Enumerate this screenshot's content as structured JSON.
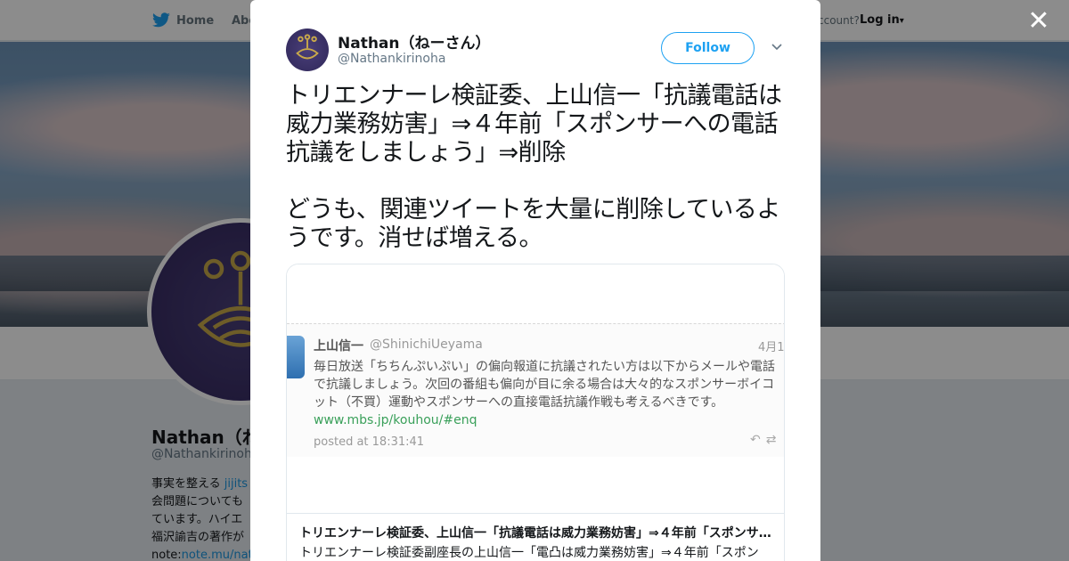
{
  "nav": {
    "home_label": "Home",
    "about_label": "Abo",
    "account_text": "ccount?",
    "login_label": "Log in"
  },
  "background_profile": {
    "name": "Nathan（ね",
    "handle": "@Nathankirinoha",
    "bio_lines": [
      {
        "text": "事実を整える ",
        "link": "jijits"
      },
      {
        "text": "会問題についても",
        "link": ""
      },
      {
        "text": "ています。ハイエ",
        "link": ""
      },
      {
        "text": "福沢諭吉の著作が",
        "link": ""
      },
      {
        "text": "note:",
        "link": "note.mu/nath"
      }
    ]
  },
  "tweet": {
    "author_name": "Nathan（ねーさん）",
    "author_handle": "@Nathankirinoha",
    "follow_label": "Follow",
    "text": "トリエンナーレ検証委、上山信一「抗議電話は威力業務妨害」⇒４年前「スポンサーへの電話抗議をしましょう」⇒削除\n\nどうも、関連ツイートを大量に削除しているようです。消せば増える。"
  },
  "card": {
    "screenshot": {
      "name": "上山信一",
      "handle": "@ShinichiUeyama",
      "date": "4月1",
      "body_lines": [
        "毎日放送「ちちんぷいぷい」の偏向報道に抗議されたい方は以下からメールや電話",
        "で抗議しましょう。次回の番組も偏向が目に余る場合は大々的なスポンサーボイコ",
        "ット（不買）運動やスポンサーへの直接電話抗議作戦も考えるべきです。"
      ],
      "link": "www.mbs.jp/kouhou/#enq",
      "posted": "posted at 18:31:41"
    },
    "title": "トリエンナーレ検証委、上山信一「抗議電話は威力業務妨害」⇒４年前「スポンサーへの電話抗議をしましょう」⇒削除",
    "description": "トリエンナーレ検証委副座長の上山信一「電凸は威力業務妨害」⇒４年前「スポン"
  },
  "colors": {
    "twitter_blue": "#1da1f2",
    "avatar_purple": "#3a2f66",
    "crest_gold": "#c9a94a"
  },
  "icons": [
    "twitter-bird-icon",
    "close-icon",
    "chevron-down-icon",
    "paulownia-crest-icon",
    "reply-icon",
    "retweet-icon"
  ]
}
